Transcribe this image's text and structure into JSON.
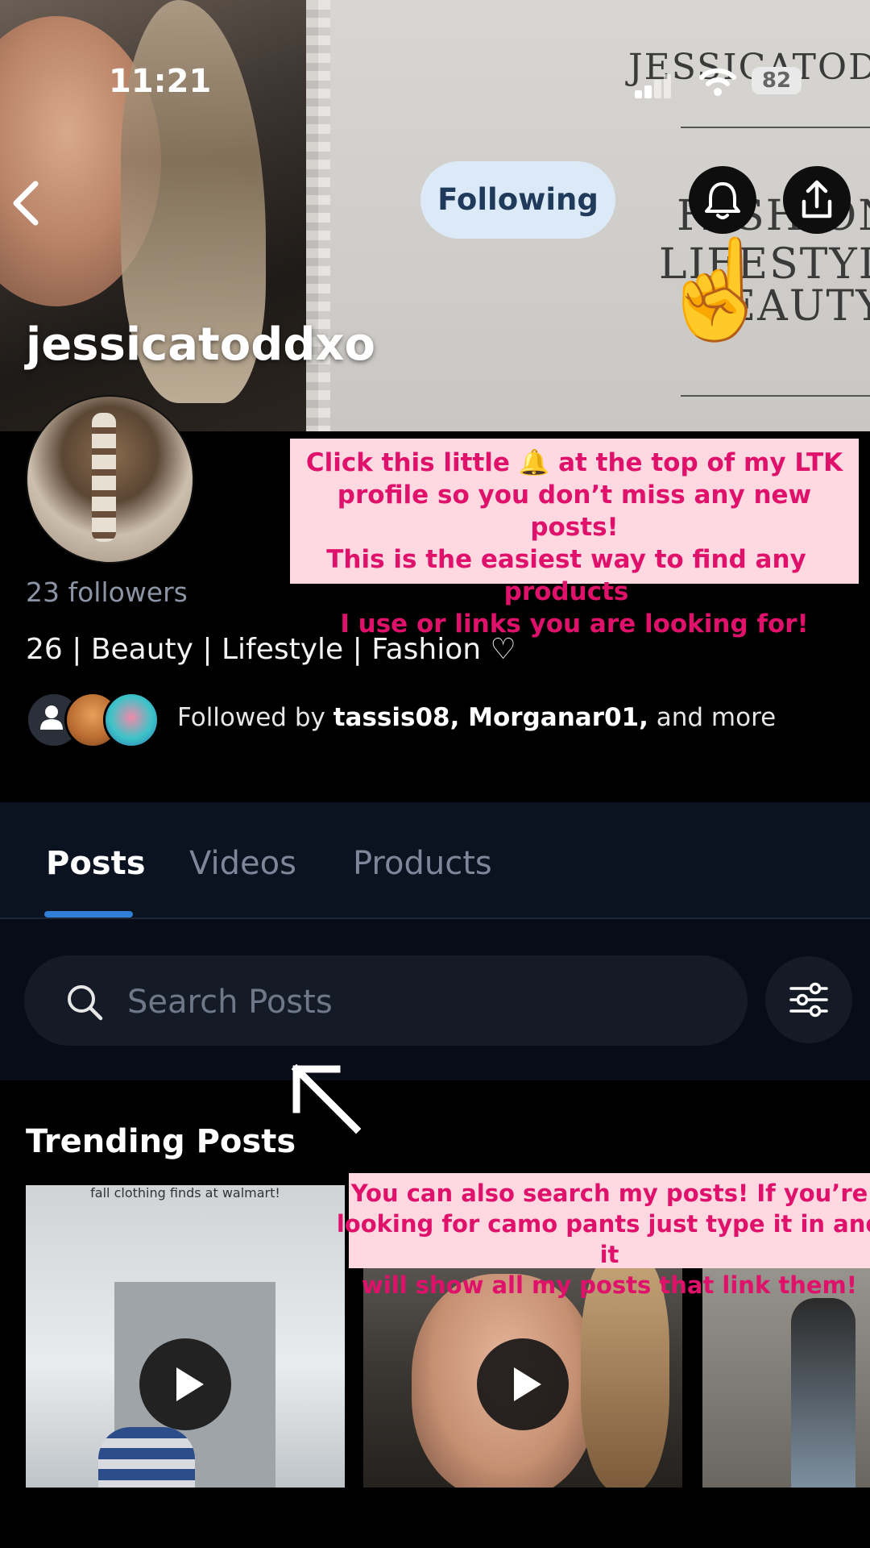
{
  "status_bar": {
    "time": "11:21",
    "battery": "82"
  },
  "profile": {
    "username": "jessicatoddxo",
    "following_label": "Following",
    "followers": "23 followers",
    "bio": "26 | Beauty | Lifestyle | Fashion ♡",
    "followed_by_prefix": "Followed by ",
    "followed_by_names": "tassis08, Morganar01,",
    "followed_by_suffix": " and more"
  },
  "banner": {
    "paper_title": "JESSICATODD",
    "paper_line1": "FASHION",
    "paper_line2": "LIFESTYLE",
    "paper_line3": "BEAUTY"
  },
  "callouts": {
    "bell_tip_line1": "Click this little 🔔 at the top of my LTK",
    "bell_tip_line2": "profile so you don’t miss any new posts!",
    "bell_tip_line3": "This is the easiest way to find any products",
    "bell_tip_line4": "I use or links you are looking for!",
    "search_tip_line1": "You can also search my posts! If you’re",
    "search_tip_line2": "looking for camo pants just type it in and it",
    "search_tip_line3": "will show all my posts that link them!"
  },
  "tabs": [
    {
      "label": "Posts",
      "active": true
    },
    {
      "label": "Videos",
      "active": false
    },
    {
      "label": "Products",
      "active": false
    }
  ],
  "search": {
    "placeholder": "Search Posts"
  },
  "trending": {
    "title": "Trending Posts",
    "thumb1_caption": "fall clothing finds at walmart!"
  },
  "colors": {
    "accent": "#2f7fd6",
    "callout_bg": "#ffd9e2",
    "callout_text": "#e0116b",
    "following_bg": "#dbeaf6"
  },
  "icons": [
    "back-arrow-icon",
    "bell-icon",
    "share-icon",
    "pointing-hand-icon",
    "search-icon",
    "filter-icon",
    "play-icon",
    "arrow-up-left-icon"
  ]
}
